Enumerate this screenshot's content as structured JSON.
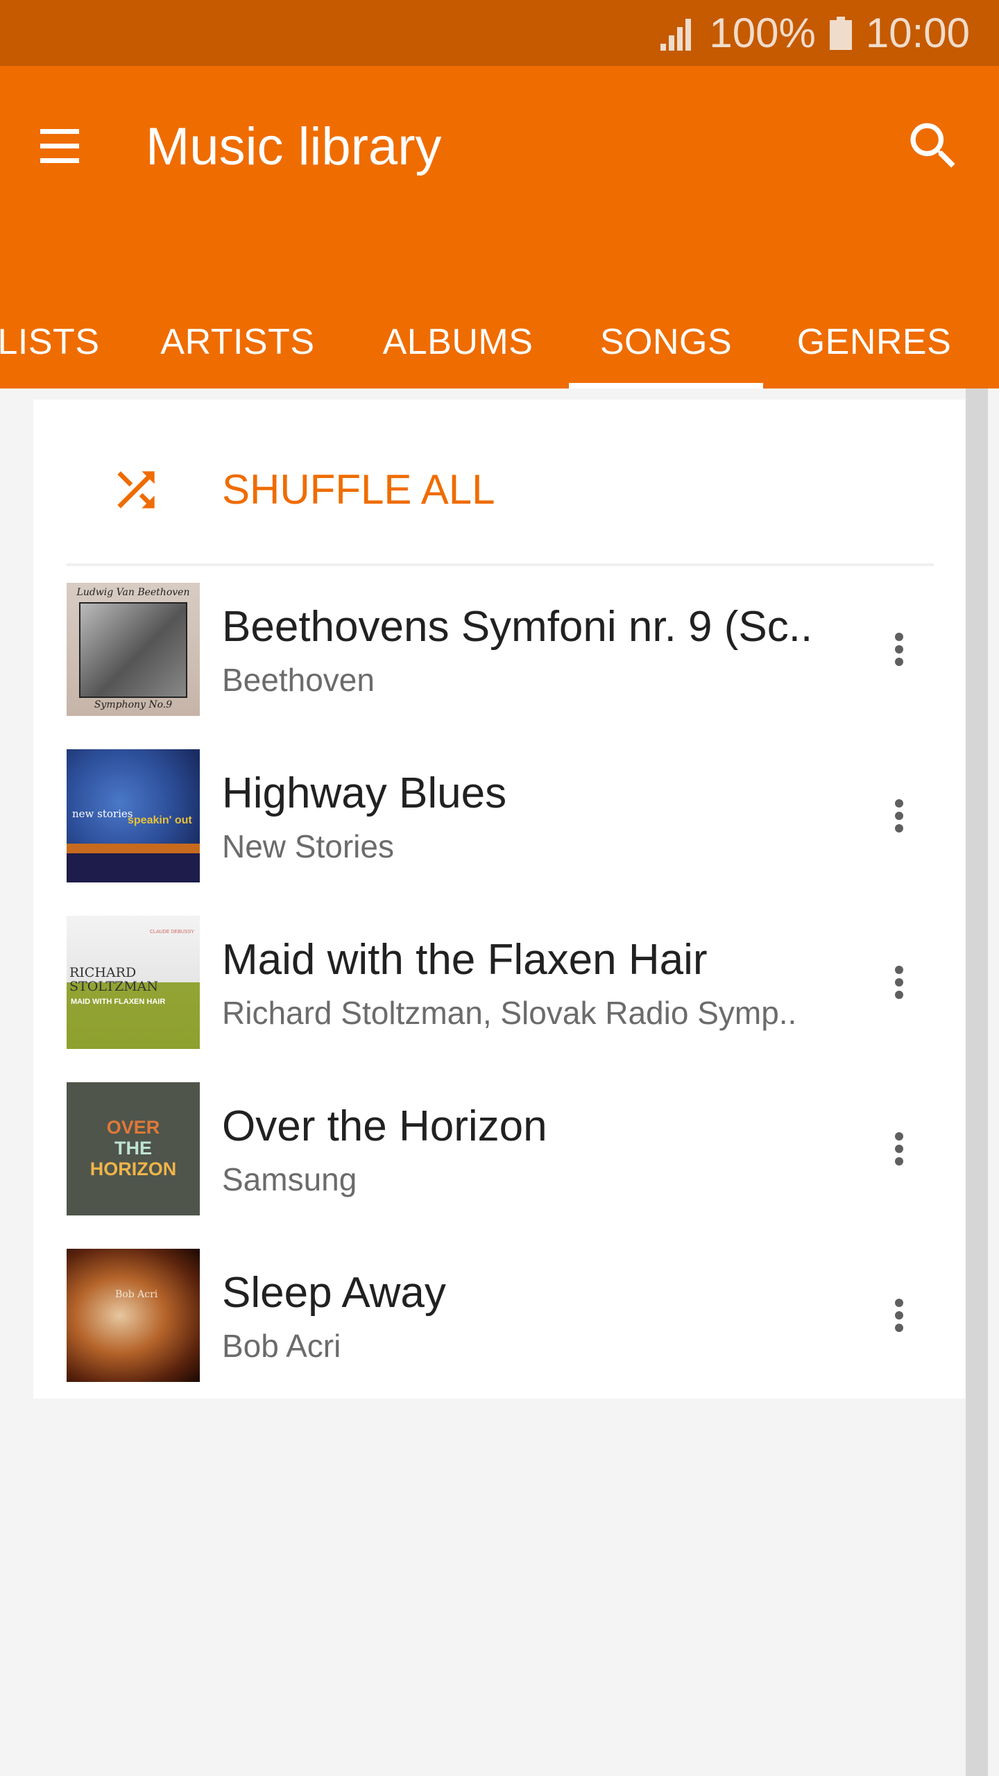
{
  "status_bar": {
    "signal_icon": "signal-icon",
    "battery_percent": "100%",
    "battery_icon": "battery-icon",
    "time": "10:00"
  },
  "app_bar": {
    "menu_icon": "hamburger-menu-icon",
    "title": "Music library",
    "search_icon": "search-icon"
  },
  "tabs": {
    "items": [
      {
        "label": "LISTS",
        "selected": false
      },
      {
        "label": "ARTISTS",
        "selected": false
      },
      {
        "label": "ALBUMS",
        "selected": false
      },
      {
        "label": "SONGS",
        "selected": true
      },
      {
        "label": "GENRES",
        "selected": false
      }
    ]
  },
  "shuffle": {
    "icon": "shuffle-icon",
    "label": "SHUFFLE ALL"
  },
  "songs": [
    {
      "title": "Beethovens Symfoni nr. 9 (Sc..",
      "artist": "Beethoven",
      "art": {
        "line1": "Ludwig Van Beethoven",
        "line2": "Symphony No.9"
      }
    },
    {
      "title": "Highway Blues",
      "artist": "New Stories",
      "art": {
        "line1": "new stories",
        "line2": "speakin' out"
      }
    },
    {
      "title": "Maid with the Flaxen Hair",
      "artist": "Richard Stoltzman, Slovak Radio Symp..",
      "art": {
        "line1": "RICHARD STOLTZMAN",
        "line2": "MAID WITH FLAXEN HAIR",
        "line3": "CLAUDE DEBUSSY"
      }
    },
    {
      "title": "Over the Horizon",
      "artist": "Samsung",
      "art": {
        "line1": "OVER",
        "line2": "THE",
        "line3": "HORIZON"
      }
    },
    {
      "title": "Sleep Away",
      "artist": "Bob Acri",
      "art": {
        "line1": "Bob Acri"
      }
    }
  ],
  "colors": {
    "accent": "#EF6C00",
    "status_bar": "#C55A00",
    "background": "#F4F4F4"
  }
}
